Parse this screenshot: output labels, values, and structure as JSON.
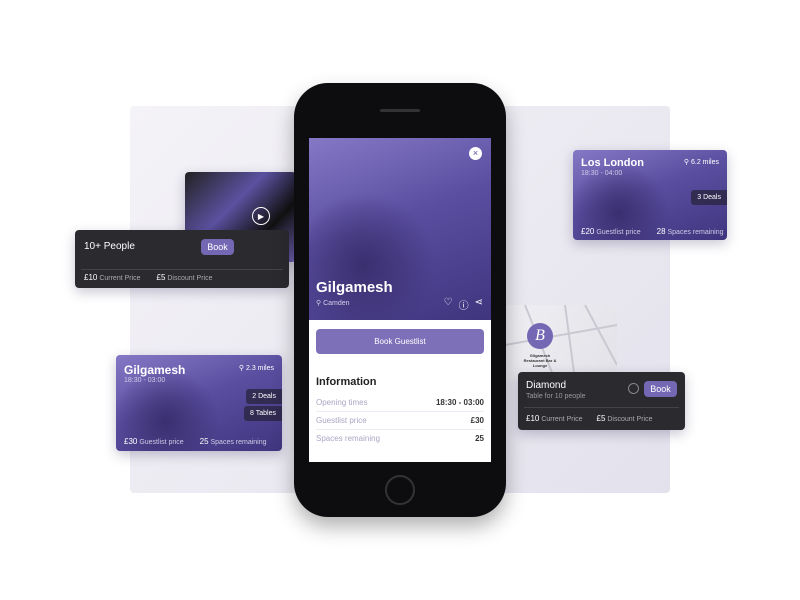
{
  "accent": "#7467b3",
  "phone": {
    "venue": "Gilgamesh",
    "location": "Camden",
    "book_label": "Book Guestlist",
    "info_title": "Information",
    "info": [
      {
        "label": "Opening times",
        "value": "18:30 - 03:00"
      },
      {
        "label": "Guestlist price",
        "value": "£30"
      },
      {
        "label": "Spaces remaining",
        "value": "25"
      }
    ]
  },
  "people_card": {
    "title": "10+ People",
    "book": "Book",
    "current_price": "£10",
    "current_label": "Current Price",
    "discount_price": "£5",
    "discount_label": "Discount Price"
  },
  "gilgamesh_card": {
    "title": "Gilgamesh",
    "distance": "2.3 miles",
    "hours": "18:30 - 03:00",
    "deals": "2",
    "deals_label": "Deals",
    "tables": "8",
    "tables_label": "Tables",
    "price": "£30",
    "price_label": "Guestlist price",
    "spaces": "25",
    "spaces_label": "Spaces remaining"
  },
  "london_card": {
    "title": "Los London",
    "distance": "6.2 miles",
    "hours": "18:30 - 04:00",
    "deals": "3",
    "deals_label": "Deals",
    "price": "£20",
    "price_label": "Guestlist price",
    "spaces": "28",
    "spaces_label": "Spaces remaining"
  },
  "map": {
    "pin_letter": "B",
    "place": "Gilgamesh Restaurant Bar & Lounge"
  },
  "diamond_card": {
    "title": "Diamond",
    "subtitle": "Table for 10 people",
    "book": "Book",
    "current_price": "£10",
    "current_label": "Current Price",
    "discount_price": "£5",
    "discount_label": "Discount Price"
  }
}
